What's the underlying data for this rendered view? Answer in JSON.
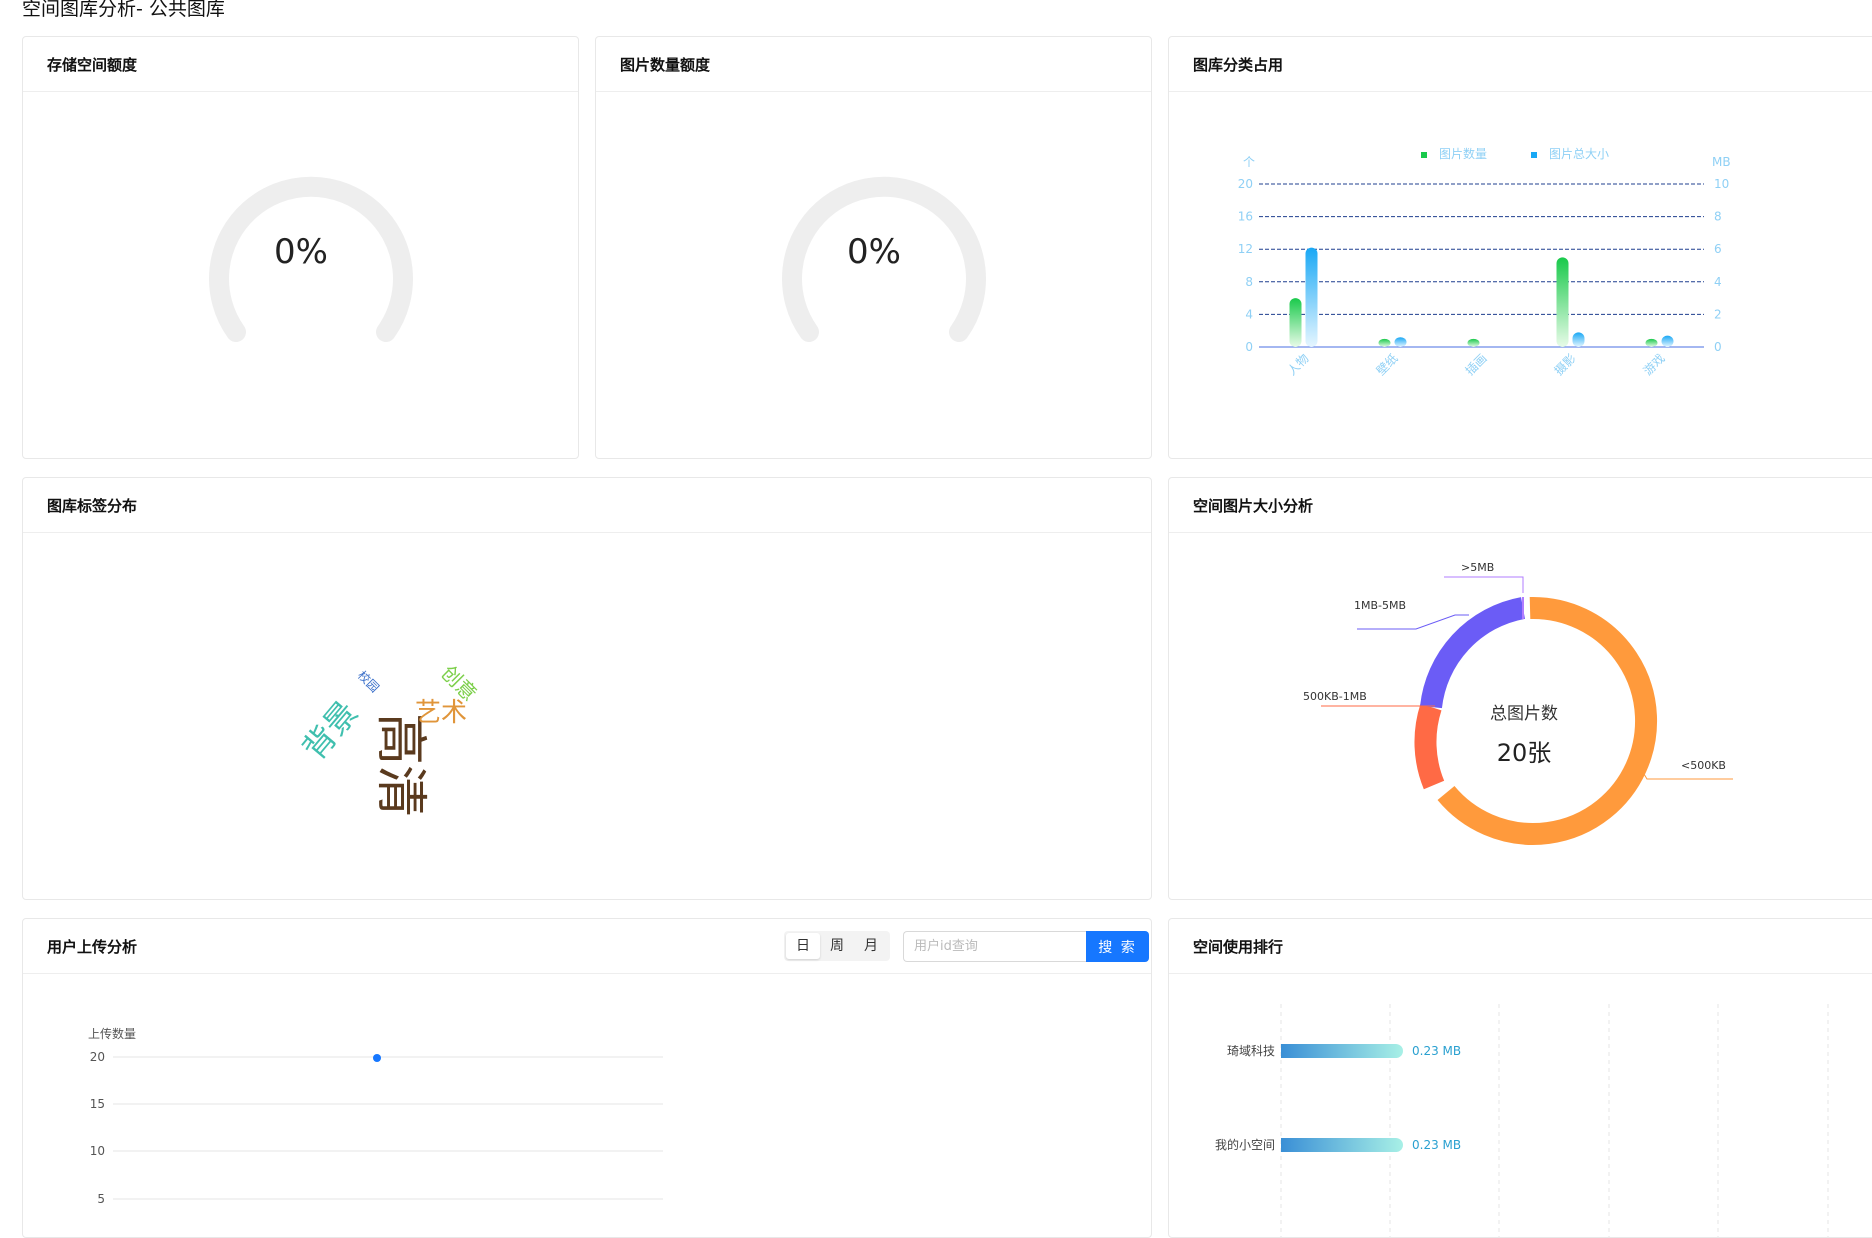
{
  "page": {
    "title": "空间图库分析- 公共图库"
  },
  "storage": {
    "title": "存储空间额度",
    "percent_label": "0%",
    "percent": 0
  },
  "count": {
    "title": "图片数量额度",
    "percent_label": "0%",
    "percent": 0
  },
  "category": {
    "title": "图库分类占用",
    "chart_data": {
      "type": "bar",
      "categories": [
        "人物",
        "壁纸",
        "插画",
        "摄影",
        "游戏"
      ],
      "series": [
        {
          "name": "图片数量",
          "values": [
            6,
            1,
            1,
            11,
            1
          ],
          "axis": "left"
        },
        {
          "name": "图片总大小",
          "values": [
            6.1,
            0.6,
            0,
            0.9,
            0.7
          ],
          "axis": "right"
        }
      ],
      "left_axis": {
        "unit": "个",
        "ticks": [
          "0",
          "4",
          "8",
          "12",
          "16",
          "20"
        ],
        "range": [
          0,
          20
        ]
      },
      "right_axis": {
        "unit": "MB",
        "ticks": [
          "0",
          "2",
          "4",
          "6",
          "8",
          "10"
        ],
        "range": [
          0,
          10
        ]
      },
      "legend_position": "top",
      "grid": true
    }
  },
  "tags": {
    "title": "图库标签分布",
    "words": [
      {
        "text": "高清",
        "color": "#5a3a1e"
      },
      {
        "text": "背景",
        "color": "#3fbfae"
      },
      {
        "text": "艺术",
        "color": "#e0953a"
      },
      {
        "text": "创意",
        "color": "#7ccf4a"
      },
      {
        "text": "校园",
        "color": "#3a6fc9"
      }
    ]
  },
  "sizes": {
    "title": "空间图片大小分析",
    "center_label": "总图片数",
    "center_value": "20张",
    "chart_data": {
      "type": "pie",
      "slices": [
        {
          "label": "<500KB",
          "value": 14,
          "color": "#ff9a3c"
        },
        {
          "label": "500KB-1MB",
          "value": 4,
          "color": "#ff6a45"
        },
        {
          "label": "1MB-5MB",
          "value": 2,
          "color": "#6b5cf6"
        },
        {
          "label": ">5MB",
          "value": 0,
          "color": "#b07cff"
        }
      ]
    }
  },
  "upload": {
    "title": "用户上传分析",
    "segments": [
      "日",
      "周",
      "月"
    ],
    "active_segment": "日",
    "search_placeholder": "用户id查询",
    "search_button": "搜 索",
    "chart_data": {
      "type": "line",
      "ylabel": "上传数量",
      "y_ticks": [
        "5",
        "10",
        "15",
        "20"
      ],
      "points": [
        {
          "y": 20
        }
      ]
    }
  },
  "rank": {
    "title": "空间使用排行",
    "chart_data": {
      "type": "bar",
      "orientation": "horizontal",
      "categories": [
        "琦域科技",
        "我的小空间"
      ],
      "values": [
        0.23,
        0.23
      ],
      "value_labels": [
        "0.23 MB",
        "0.23 MB"
      ]
    }
  }
}
